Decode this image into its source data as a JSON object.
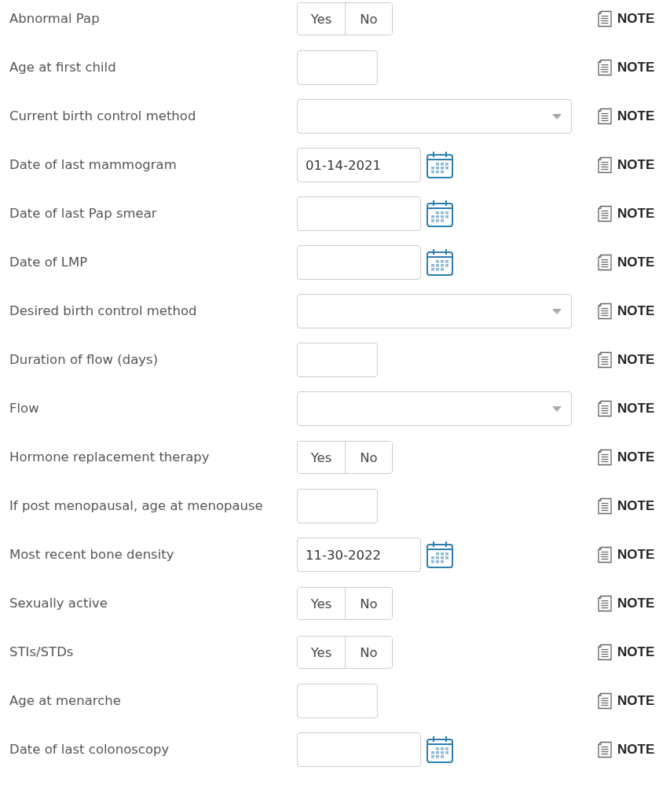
{
  "rows": [
    {
      "label": "Abnormal Pap",
      "kind": "yesno",
      "options": [
        {
          "label": "Yes",
          "selected": false
        },
        {
          "label": "No",
          "selected": false
        }
      ],
      "note": "NOTE"
    },
    {
      "label": "Age at first child",
      "kind": "text",
      "note": "NOTE"
    },
    {
      "label": "Current birth control method",
      "kind": "select",
      "note": "NOTE"
    },
    {
      "label": "Date of last mammogram",
      "kind": "date",
      "value": "01-14-2021",
      "note": "NOTE"
    },
    {
      "label": "Date of last Pap smear",
      "kind": "date",
      "note": "NOTE"
    },
    {
      "label": "Date of LMP",
      "kind": "date",
      "note": "NOTE"
    },
    {
      "label": "Desired birth control method",
      "kind": "select",
      "note": "NOTE"
    },
    {
      "label": "Duration of flow (days)",
      "kind": "text",
      "note": "NOTE"
    },
    {
      "label": "Flow",
      "kind": "select",
      "note": "NOTE"
    },
    {
      "label": "Hormone replacement therapy",
      "kind": "yesno",
      "options": [
        {
          "label": "Yes",
          "selected": false
        },
        {
          "label": "No",
          "selected": false
        }
      ],
      "note": "NOTE"
    },
    {
      "label": "If post menopausal, age at menopause",
      "kind": "text",
      "note": "NOTE"
    },
    {
      "label": "Most recent bone density",
      "kind": "date",
      "value": "11-30-2022",
      "note": "NOTE"
    },
    {
      "label": "Sexually active",
      "kind": "yesno",
      "options": [
        {
          "label": "Yes",
          "selected": false
        },
        {
          "label": "No",
          "selected": false
        }
      ],
      "note": "NOTE"
    },
    {
      "label": "STIs/STDs",
      "kind": "yesno",
      "options": [
        {
          "label": "Yes",
          "selected": false
        },
        {
          "label": "No",
          "selected": false
        }
      ],
      "note": "NOTE"
    },
    {
      "label": "Age at menarche",
      "kind": "text",
      "note": "NOTE"
    },
    {
      "label": "Date of last colonoscopy",
      "kind": "date",
      "note": "NOTE"
    }
  ]
}
